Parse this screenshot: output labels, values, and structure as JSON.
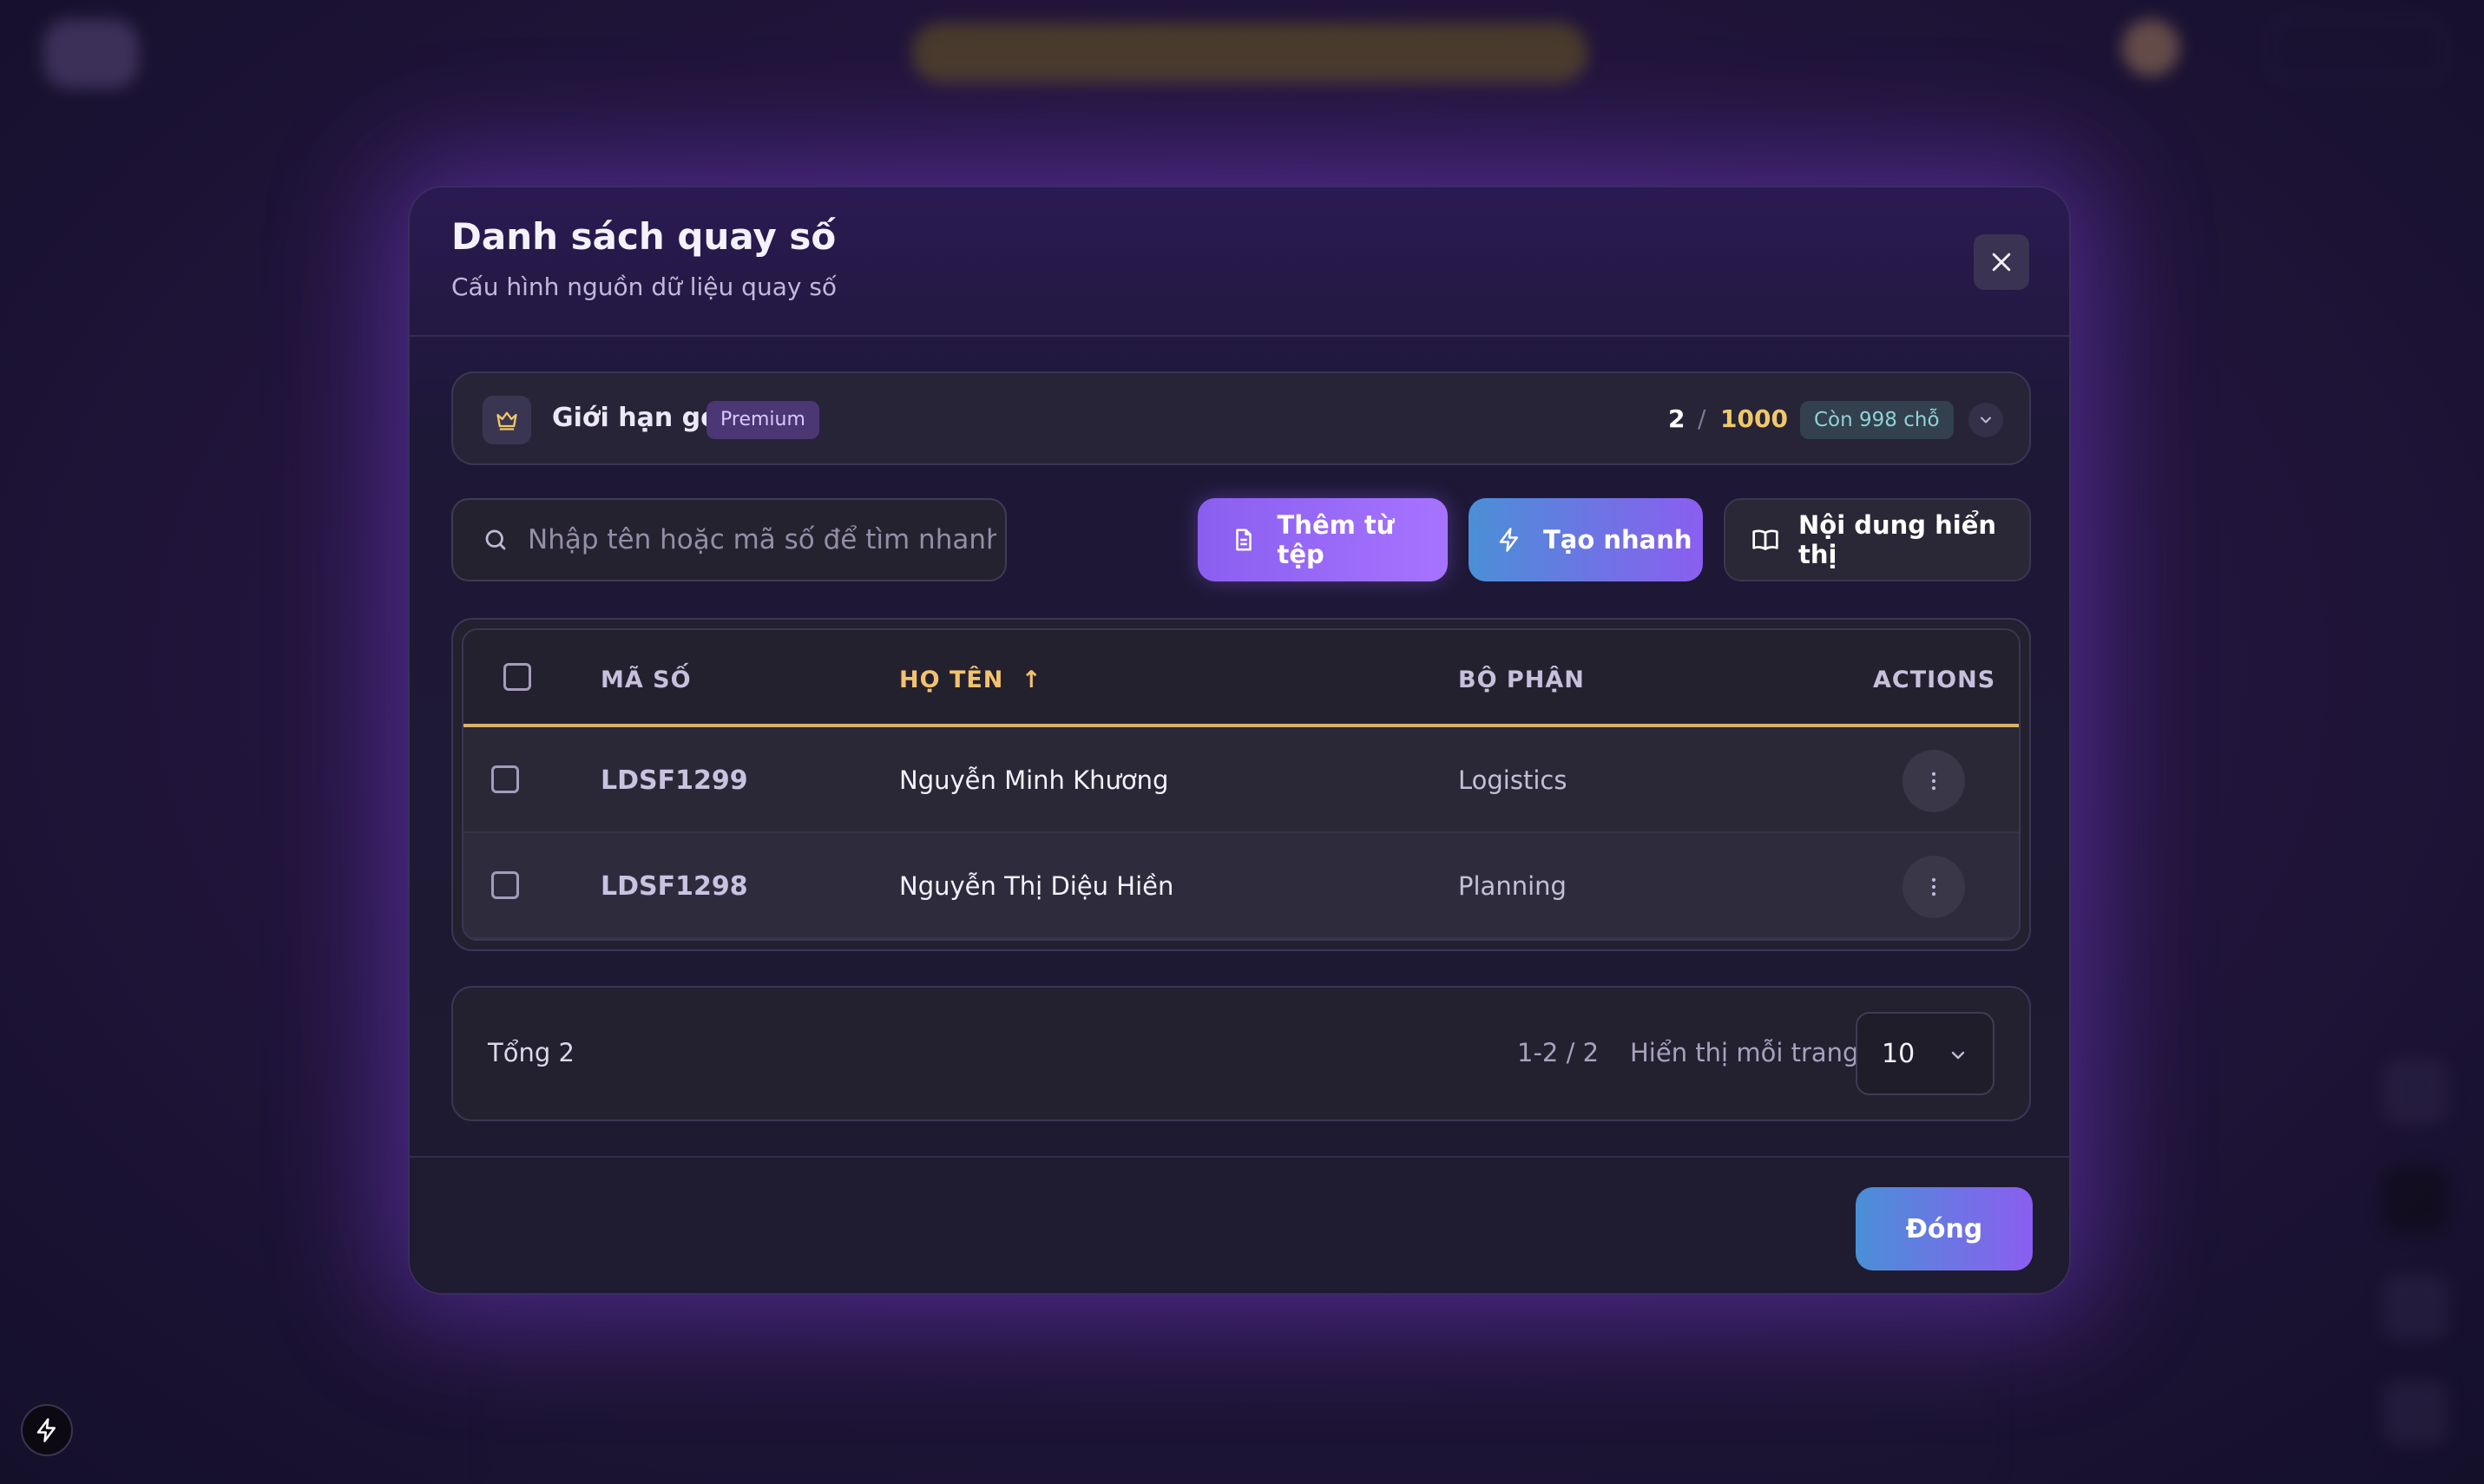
{
  "modal": {
    "title": "Danh sách quay số",
    "subtitle": "Cấu hình nguồn dữ liệu quay số"
  },
  "plan": {
    "label": "Giới hạn gói",
    "badge": "Premium",
    "used": "2",
    "separator": "/",
    "limit": "1000",
    "remaining": "Còn 998 chỗ"
  },
  "toolbar": {
    "search_placeholder": "Nhập tên hoặc mã số để tìm nhanh",
    "add_from_file": "Thêm từ tệp",
    "quick_create": "Tạo nhanh",
    "display_content": "Nội dung hiển thị"
  },
  "table": {
    "columns": {
      "code": "MÃ SỐ",
      "name": "HỌ TÊN",
      "name_sort": "↑",
      "department": "BỘ PHẬN",
      "actions": "ACTIONS"
    },
    "rows": [
      {
        "code": "LDSF1299",
        "name": "Nguyễn Minh Khương",
        "department": "Logistics"
      },
      {
        "code": "LDSF1298",
        "name": "Nguyễn Thị Diệu Hiền",
        "department": "Planning"
      }
    ]
  },
  "pagination": {
    "total": "Tổng 2",
    "range": "1-2 / 2",
    "per_page_label": "Hiển thị mỗi trang",
    "per_page_value": "10"
  },
  "footer": {
    "close_label": "Đóng"
  },
  "colors": {
    "accent_purple": "#8a5ff0",
    "accent_gold": "#f1c869",
    "accent_teal": "#8fd2d6"
  },
  "icons": [
    "close-icon",
    "crown-icon",
    "chevron-down-icon",
    "search-icon",
    "file-icon",
    "lightning-icon",
    "book-icon",
    "more-vertical-icon"
  ]
}
